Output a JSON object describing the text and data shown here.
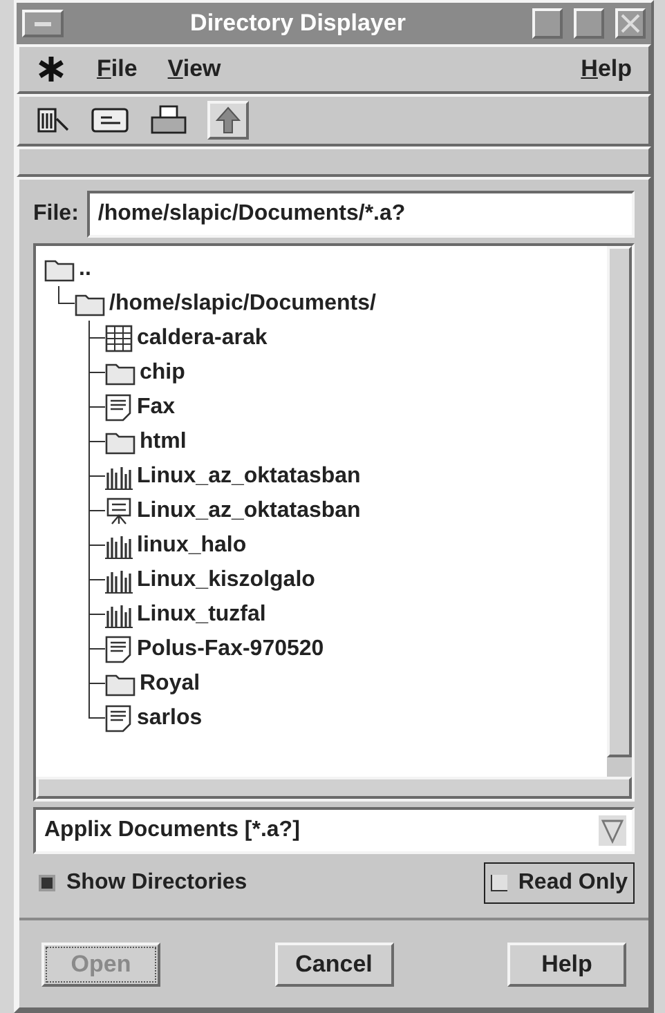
{
  "window": {
    "title": "Directory Displayer"
  },
  "menu": [
    {
      "label": "File",
      "first_letter_underlined": true
    },
    {
      "label": "View",
      "first_letter_underlined": true
    },
    {
      "label": "Help",
      "first_letter_underlined": true
    }
  ],
  "file_field": {
    "label": "File:",
    "value": "/home/slapic/Documents/*.a?"
  },
  "tree": [
    {
      "label": "..",
      "kind": "folder",
      "children": [
        {
          "label": "/home/slapic/Documents/",
          "kind": "folder",
          "children": [
            {
              "label": "caldera-arak",
              "kind": "spreadsheet"
            },
            {
              "label": "chip",
              "kind": "folder"
            },
            {
              "label": "Fax",
              "kind": "document"
            },
            {
              "label": "html",
              "kind": "folder"
            },
            {
              "label": "Linux_az_oktatasban",
              "kind": "graphics"
            },
            {
              "label": "Linux_az_oktatasban",
              "kind": "presentation"
            },
            {
              "label": "linux_halo",
              "kind": "graphics"
            },
            {
              "label": "Linux_kiszolgalo",
              "kind": "graphics"
            },
            {
              "label": "Linux_tuzfal",
              "kind": "graphics"
            },
            {
              "label": "Polus-Fax-970520",
              "kind": "document"
            },
            {
              "label": "Royal",
              "kind": "folder"
            },
            {
              "label": "sarlos",
              "kind": "document"
            }
          ]
        }
      ]
    }
  ],
  "filter": {
    "value": "Applix Documents [*.a?]"
  },
  "options": [
    {
      "label": "Show Directories",
      "checked": true
    },
    {
      "label": "Read Only",
      "checked": false
    }
  ],
  "buttons": [
    {
      "label": "Open",
      "disabled": true
    },
    {
      "label": "Cancel",
      "disabled": false
    },
    {
      "label": "Help",
      "disabled": false
    }
  ]
}
